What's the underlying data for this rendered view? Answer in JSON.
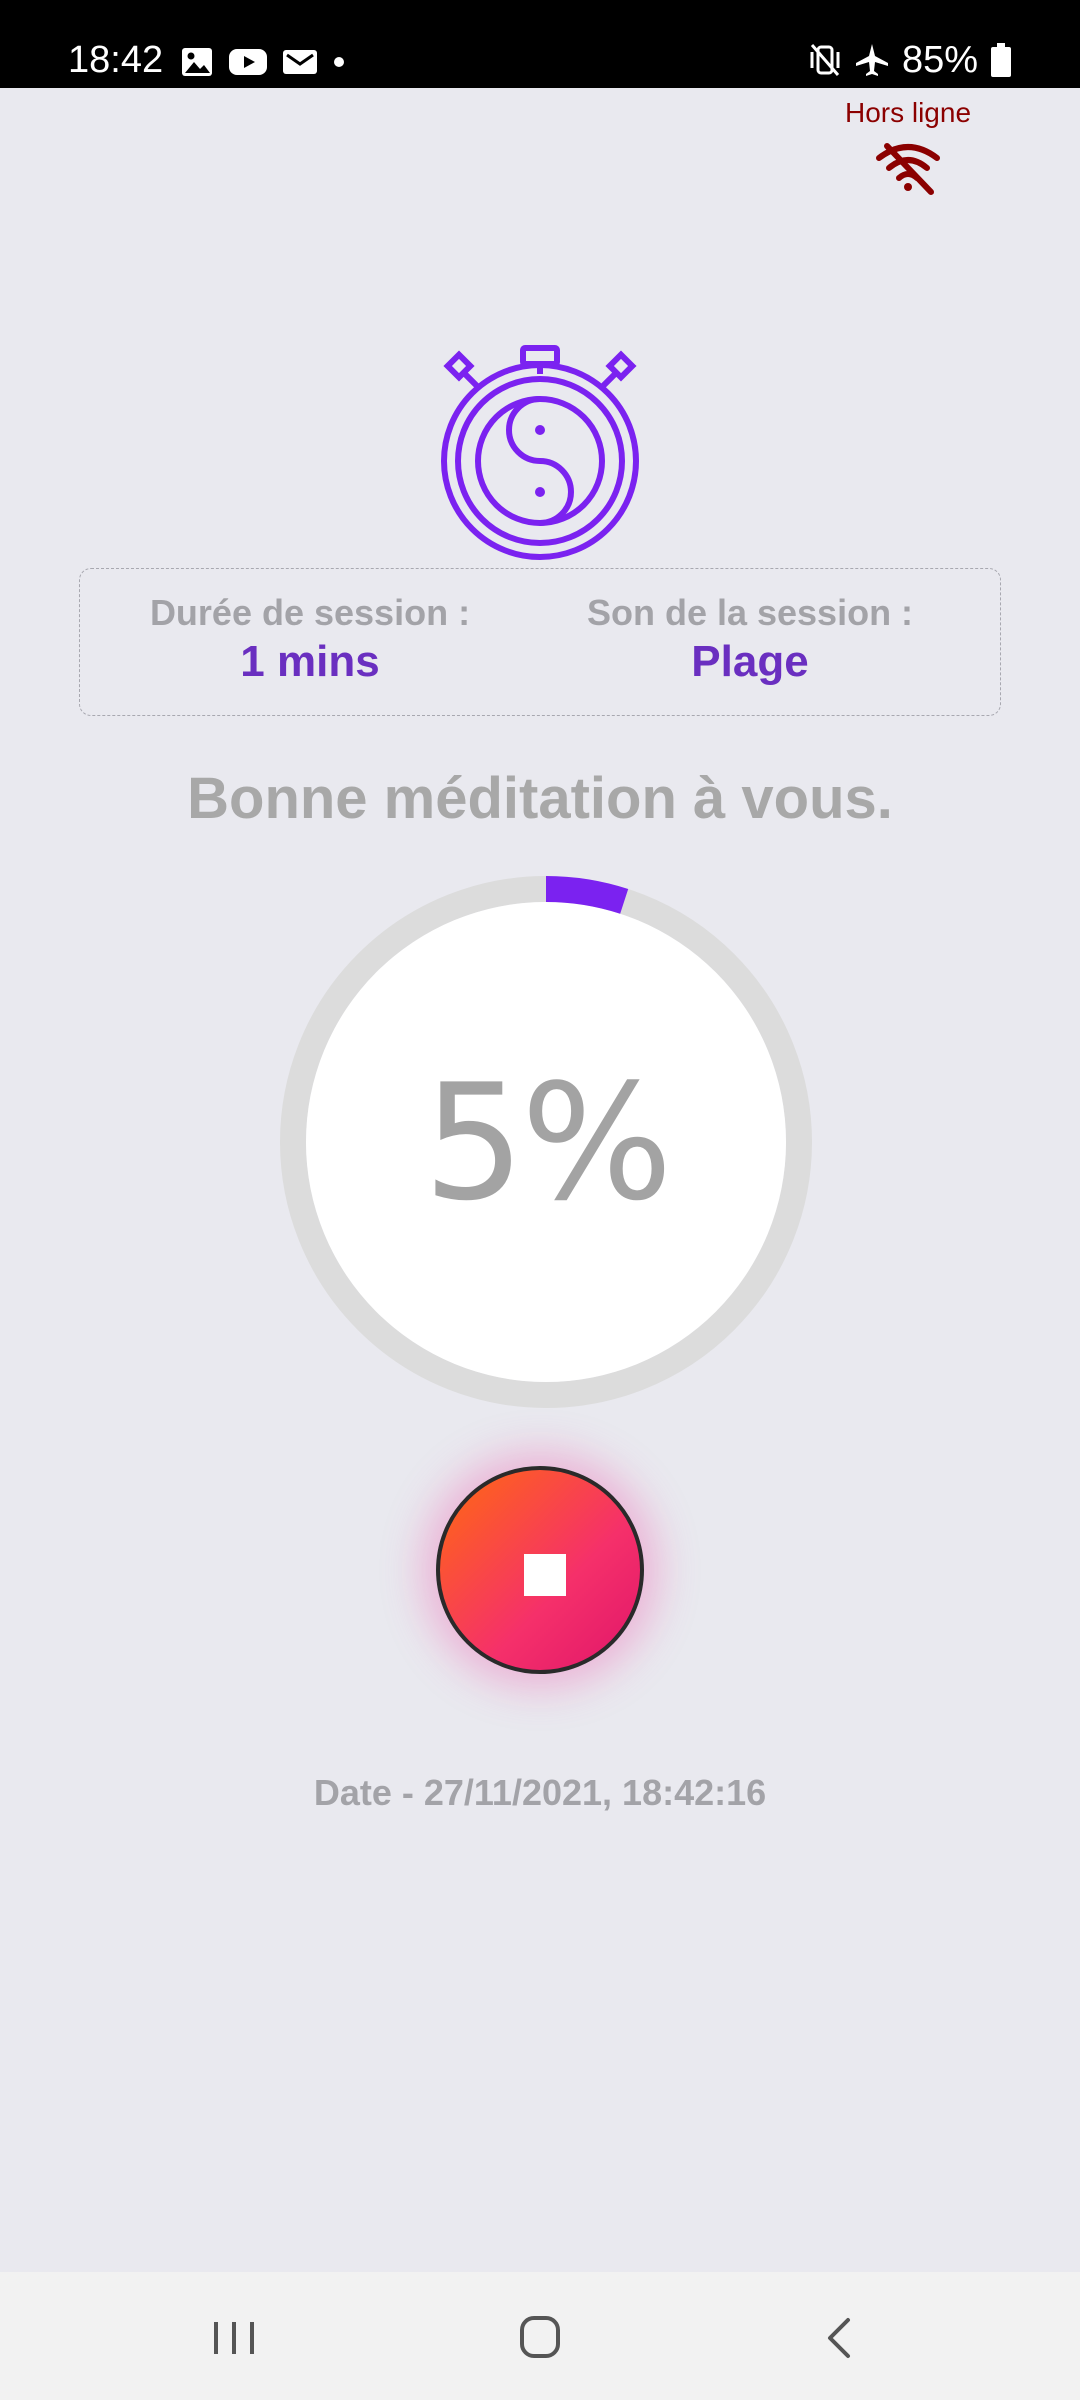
{
  "status_bar": {
    "time": "18:42",
    "battery": "85%",
    "left_icons": [
      "gallery-icon",
      "youtube-icon",
      "mail-icon",
      "dot-icon"
    ],
    "right_icons": [
      "vibrate-off-icon",
      "airplane-icon",
      "battery-icon"
    ]
  },
  "connection": {
    "label": "Hors ligne",
    "icon": "wifi-off-icon",
    "color": "#8b0000"
  },
  "session_info": {
    "duration_label": "Durée de session :",
    "duration_value": "1 mins",
    "sound_label": "Son de la session :",
    "sound_value": "Plage"
  },
  "greeting": "Bonne méditation à vous.",
  "progress": {
    "percent": 5,
    "text": "5%",
    "color": "#7b22f0",
    "track_color": "#dcdcdc"
  },
  "date_line": "Date - 27/11/2021, 18:42:16",
  "colors": {
    "accent": "#7b22f0",
    "value_text": "#6a2fc0",
    "muted_text": "#a3a3a8"
  }
}
